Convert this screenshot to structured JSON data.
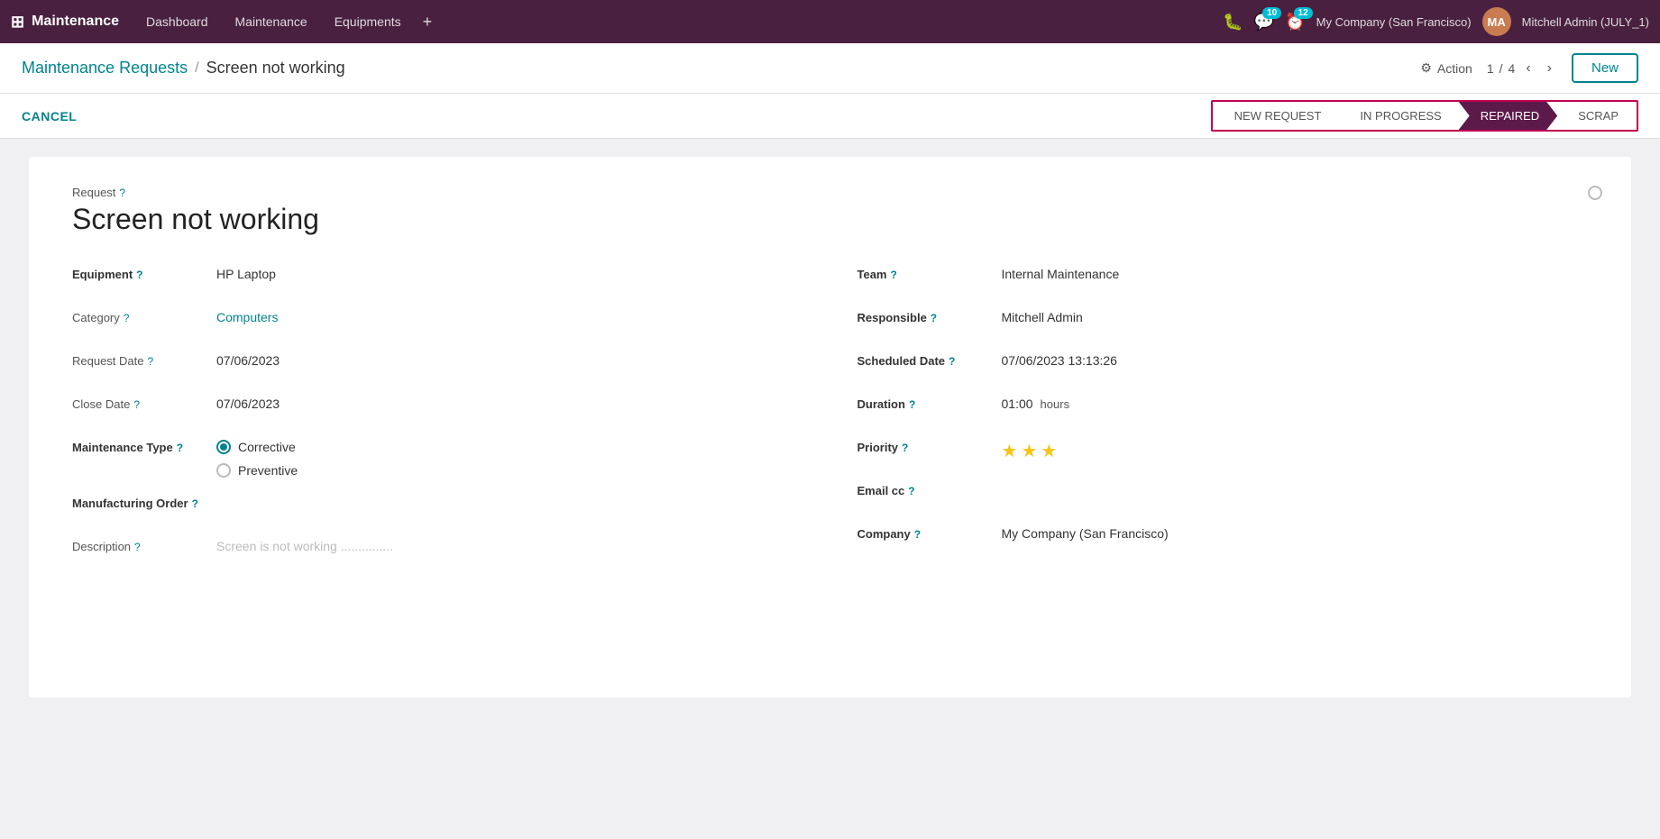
{
  "topnav": {
    "brand": "Maintenance",
    "links": [
      "Dashboard",
      "Maintenance",
      "Equipments"
    ],
    "plus": "+",
    "notifications": [
      {
        "icon": "🐛",
        "count": null
      },
      {
        "icon": "💬",
        "count": "10"
      },
      {
        "icon": "🕐",
        "count": "12"
      }
    ],
    "company": "My Company (San Francisco)",
    "user": "Mitchell Admin (JULY_1)",
    "user_initials": "MA"
  },
  "subheader": {
    "breadcrumb_parent": "Maintenance Requests",
    "breadcrumb_sep": "/",
    "breadcrumb_current": "Screen not working",
    "action_icon": "⚙",
    "action_label": "Action",
    "pagination_current": "1",
    "pagination_total": "4",
    "new_label": "New"
  },
  "statusbar": {
    "cancel_label": "CANCEL",
    "stages": [
      {
        "label": "NEW REQUEST",
        "active": false
      },
      {
        "label": "IN PROGRESS",
        "active": false
      },
      {
        "label": "REPAIRED",
        "active": true
      },
      {
        "label": "SCRAP",
        "active": false
      }
    ]
  },
  "form": {
    "request_label": "Request",
    "request_title": "Screen not working",
    "left_fields": [
      {
        "label": "Equipment",
        "bold": true,
        "value": "HP Laptop",
        "teal": false
      },
      {
        "label": "Category",
        "bold": false,
        "value": "Computers",
        "teal": true
      },
      {
        "label": "Request Date",
        "bold": false,
        "value": "07/06/2023",
        "teal": false
      },
      {
        "label": "Close Date",
        "bold": false,
        "value": "07/06/2023",
        "teal": false
      }
    ],
    "maintenance_type_label": "Maintenance Type",
    "maintenance_type_bold": true,
    "maintenance_options": [
      {
        "label": "Corrective",
        "checked": true
      },
      {
        "label": "Preventive",
        "checked": false
      }
    ],
    "manufacturing_order_label": "Manufacturing Order",
    "description_label": "Description",
    "description_value": "Screen is not working ...............",
    "right_fields": [
      {
        "label": "Team",
        "bold": true,
        "value": "Internal Maintenance",
        "teal": false
      },
      {
        "label": "Responsible",
        "bold": true,
        "value": "Mitchell Admin",
        "teal": false
      },
      {
        "label": "Scheduled Date",
        "bold": true,
        "value": "07/06/2023 13:13:26",
        "teal": false
      },
      {
        "label": "Duration",
        "bold": true,
        "value": "01:00",
        "unit": "hours"
      },
      {
        "label": "Priority",
        "bold": true,
        "stars": 3,
        "max_stars": 3
      },
      {
        "label": "Email cc",
        "bold": true,
        "value": ""
      },
      {
        "label": "Company",
        "bold": true,
        "value": "My Company (San Francisco)",
        "teal": false
      }
    ]
  }
}
